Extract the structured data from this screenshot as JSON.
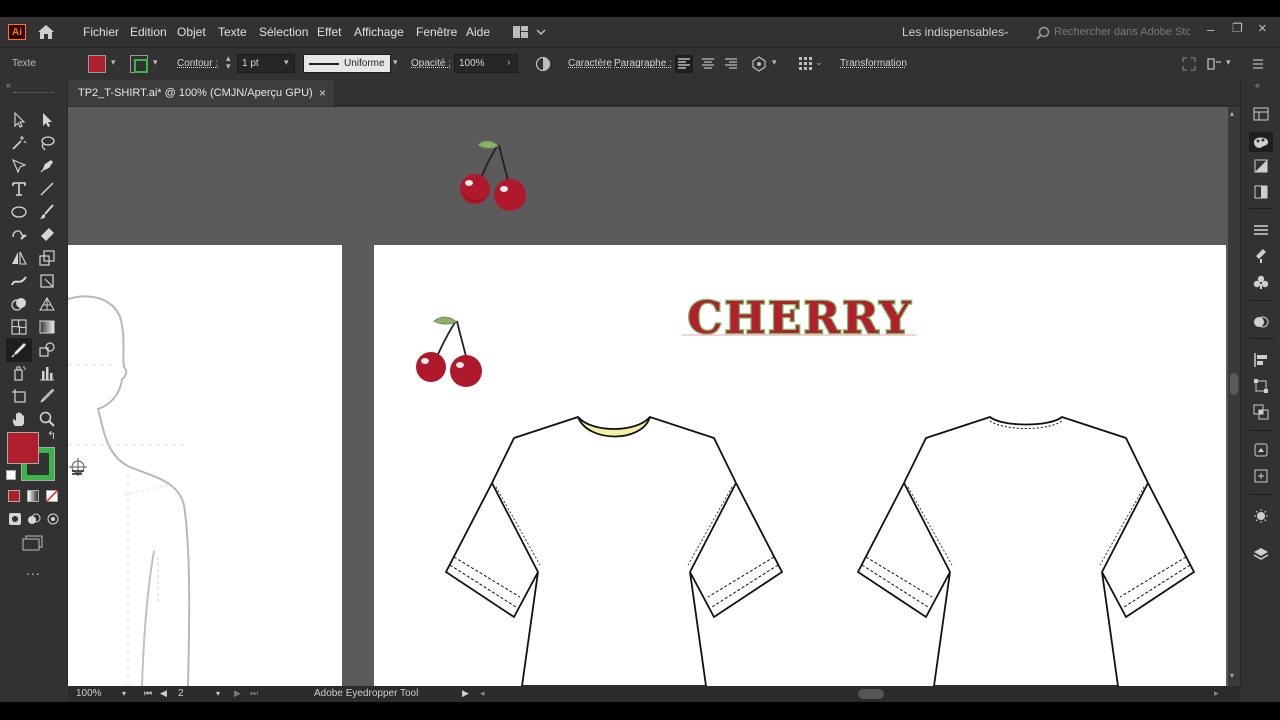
{
  "app": {
    "logo_text": "Ai",
    "menu": [
      "Fichier",
      "Edition",
      "Objet",
      "Texte",
      "Sélection",
      "Effet",
      "Affichage",
      "Fenêtre",
      "Aide"
    ],
    "workspace_label": "Les indispensables",
    "search_placeholder": "Rechercher dans Adobe Stock"
  },
  "control_bar": {
    "context_label": "Texte",
    "contour_label": "Contour :",
    "stroke_weight": "1 pt",
    "stroke_profile": "Uniforme",
    "opacity_label": "Opacité :",
    "opacity_value": "100%",
    "caractere_label": "Caractère",
    "paragraphe_label": "Paragraphe :",
    "transformation_label": "Transformation",
    "fill_color": "#b01e2e",
    "stroke_color": "#3bb44a"
  },
  "document": {
    "tab_title": "TP2_T-SHIRT.ai* @ 100% (CMJN/Aperçu GPU)",
    "tab_close": "×"
  },
  "artwork": {
    "headline": "CHERRY",
    "headline_fill": "#b21f2d",
    "headline_stroke": "#7ac26a",
    "collar_color": "#f3f0a6",
    "cherry_color": "#b0182c",
    "leaf_color": "#8ab06a"
  },
  "status_bar": {
    "zoom": "100%",
    "artboard_number": "2",
    "current_tool": "Adobe Eyedropper Tool"
  },
  "toolbar": {
    "fill_swatch": "#b01e2e",
    "stroke_swatch": "#3bb44a",
    "more_label": "..."
  }
}
